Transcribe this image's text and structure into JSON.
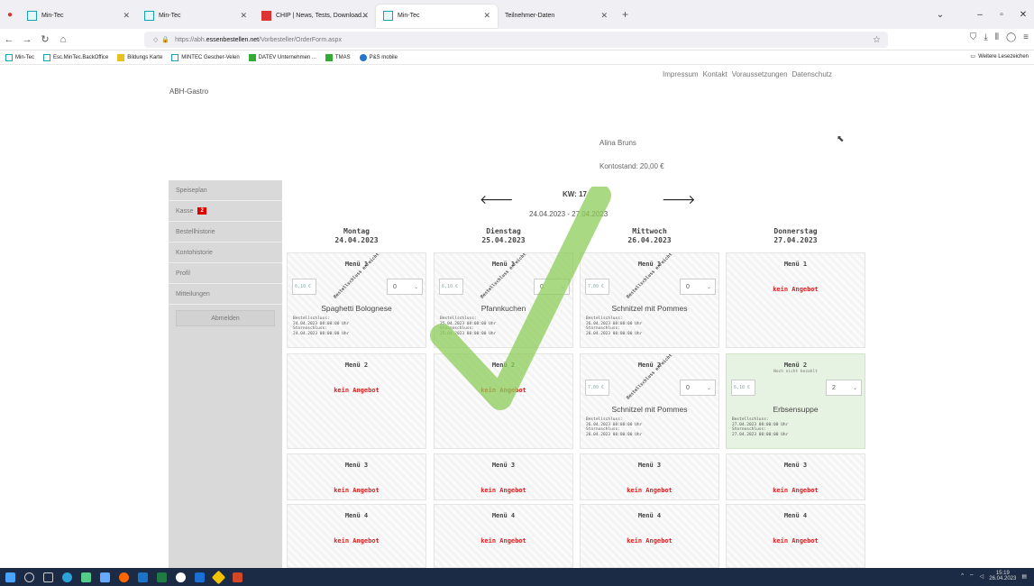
{
  "browser": {
    "tabs": [
      {
        "title": "Min-Tec",
        "icon": "min-tec-favicon"
      },
      {
        "title": "Min-Tec",
        "icon": "min-tec-favicon"
      },
      {
        "title": "CHIP | News, Tests, Download...",
        "icon": "chip-favicon"
      },
      {
        "title": "Min-Tec",
        "icon": "min-tec-favicon",
        "active": true
      },
      {
        "title": "Teilnehmer-Daten",
        "icon": "none"
      }
    ],
    "url_prefix": "https://abh.",
    "url_domain": "essenbestellen.net",
    "url_path": "/Vorbesteller/OrderForm.aspx",
    "bookmarks": [
      "Min-Tec",
      "Esc.MinTec.BackOffice",
      "Bildungs Karte",
      "MINTEC Gescher-Velen",
      "DATEV Unternehmen ...",
      "TMAS",
      "P&S mobile"
    ],
    "bookmarks_right": "Weitere Lesezeichen"
  },
  "site": {
    "top_links": [
      "Impressum",
      "Kontakt",
      "Voraussetzungen",
      "Datenschutz"
    ],
    "brand": "ABH-Gastro",
    "user_name": "Alina Bruns",
    "balance": "Kontostand: 20,00 €"
  },
  "sidebar": {
    "items": [
      "Speiseplan",
      "Kasse",
      "Bestellhistorie",
      "Kontohistorie",
      "Profil",
      "Mitteilungen"
    ],
    "cart_badge": "2",
    "logout": "Abmelden"
  },
  "week": {
    "prev_icon": "arrow-left-icon",
    "next_icon": "arrow-right-icon",
    "label": "KW: 17",
    "range": "24.04.2023 - 27.04.2023"
  },
  "days": [
    {
      "name": "Montag",
      "date": "24.04.2023"
    },
    {
      "name": "Dienstag",
      "date": "25.04.2023"
    },
    {
      "name": "Mittwoch",
      "date": "26.04.2023"
    },
    {
      "name": "Donnerstag",
      "date": "27.04.2023"
    }
  ],
  "menus": [
    [
      {
        "title": "Menü 1",
        "price": "6,10 €",
        "qty": "0",
        "dish": "Spaghetti Bolognese",
        "closed": "Bestellschluss erreicht",
        "info": [
          "Bestellschluss:",
          "24.04.2023 08:00:00 Uhr",
          "Stornoschluss:",
          "24.04.2023 08:00:00 Uhr"
        ]
      },
      {
        "title": "Menü 1",
        "price": "6,10 €",
        "qty": "0",
        "dish": "Pfannkuchen",
        "closed": "Bestellschluss erreicht",
        "info": [
          "Bestellschluss:",
          "25.04.2023 08:00:00 Uhr",
          "Stornoschluss:",
          "25.04.2023 08:00:00 Uhr"
        ]
      },
      {
        "title": "Menü 1",
        "price": "7,00 €",
        "qty": "0",
        "dish": "Schnitzel mit Pommes",
        "closed": "Bestellschluss erreicht",
        "info": [
          "Bestellschluss:",
          "26.04.2023 08:00:00 Uhr",
          "Stornoschluss:",
          "26.04.2023 08:00:00 Uhr"
        ]
      },
      {
        "title": "Menü 1",
        "kein": "kein Angebot"
      }
    ],
    [
      {
        "title": "Menü 2",
        "kein": "kein Angebot"
      },
      {
        "title": "Menü 2",
        "kein": "kein Angebot"
      },
      {
        "title": "Menü 2",
        "price": "7,00 €",
        "qty": "0",
        "dish": "Schnitzel mit Pommes",
        "closed": "Bestellschluss erreicht",
        "info": [
          "Bestellschluss:",
          "26.04.2023 08:00:00 Uhr",
          "Stornoschluss:",
          "26.04.2023 08:00:00 Uhr"
        ]
      },
      {
        "title": "Menü 2",
        "unpaid": "Noch nicht bezahlt",
        "price": "6,10 €",
        "qty": "2",
        "dish": "Erbsensuppe",
        "green": true,
        "info": [
          "Bestellschluss:",
          "27.04.2023 08:00:00 Uhr",
          "Stornoschluss:",
          "27.04.2023 08:00:00 Uhr"
        ]
      }
    ],
    [
      {
        "title": "Menü 3",
        "kein": "kein Angebot"
      },
      {
        "title": "Menü 3",
        "kein": "kein Angebot"
      },
      {
        "title": "Menü 3",
        "kein": "kein Angebot"
      },
      {
        "title": "Menü 3",
        "kein": "kein Angebot"
      }
    ],
    [
      {
        "title": "Menü 4",
        "kein": "kein Angebot"
      },
      {
        "title": "Menü 4",
        "kein": "kein Angebot"
      },
      {
        "title": "Menü 4",
        "kein": "kein Angebot"
      },
      {
        "title": "Menü 4",
        "kein": "kein Angebot"
      }
    ]
  ],
  "taskbar": {
    "time": "15:19",
    "date": "26.04.2023"
  },
  "colors": {
    "accent_red": "#e02020",
    "sidebar_bg": "#d9d9d9",
    "ordered_green": "#e7f3e2",
    "taskbar": "#1c2b45",
    "check_green": "#8ccd5a"
  }
}
